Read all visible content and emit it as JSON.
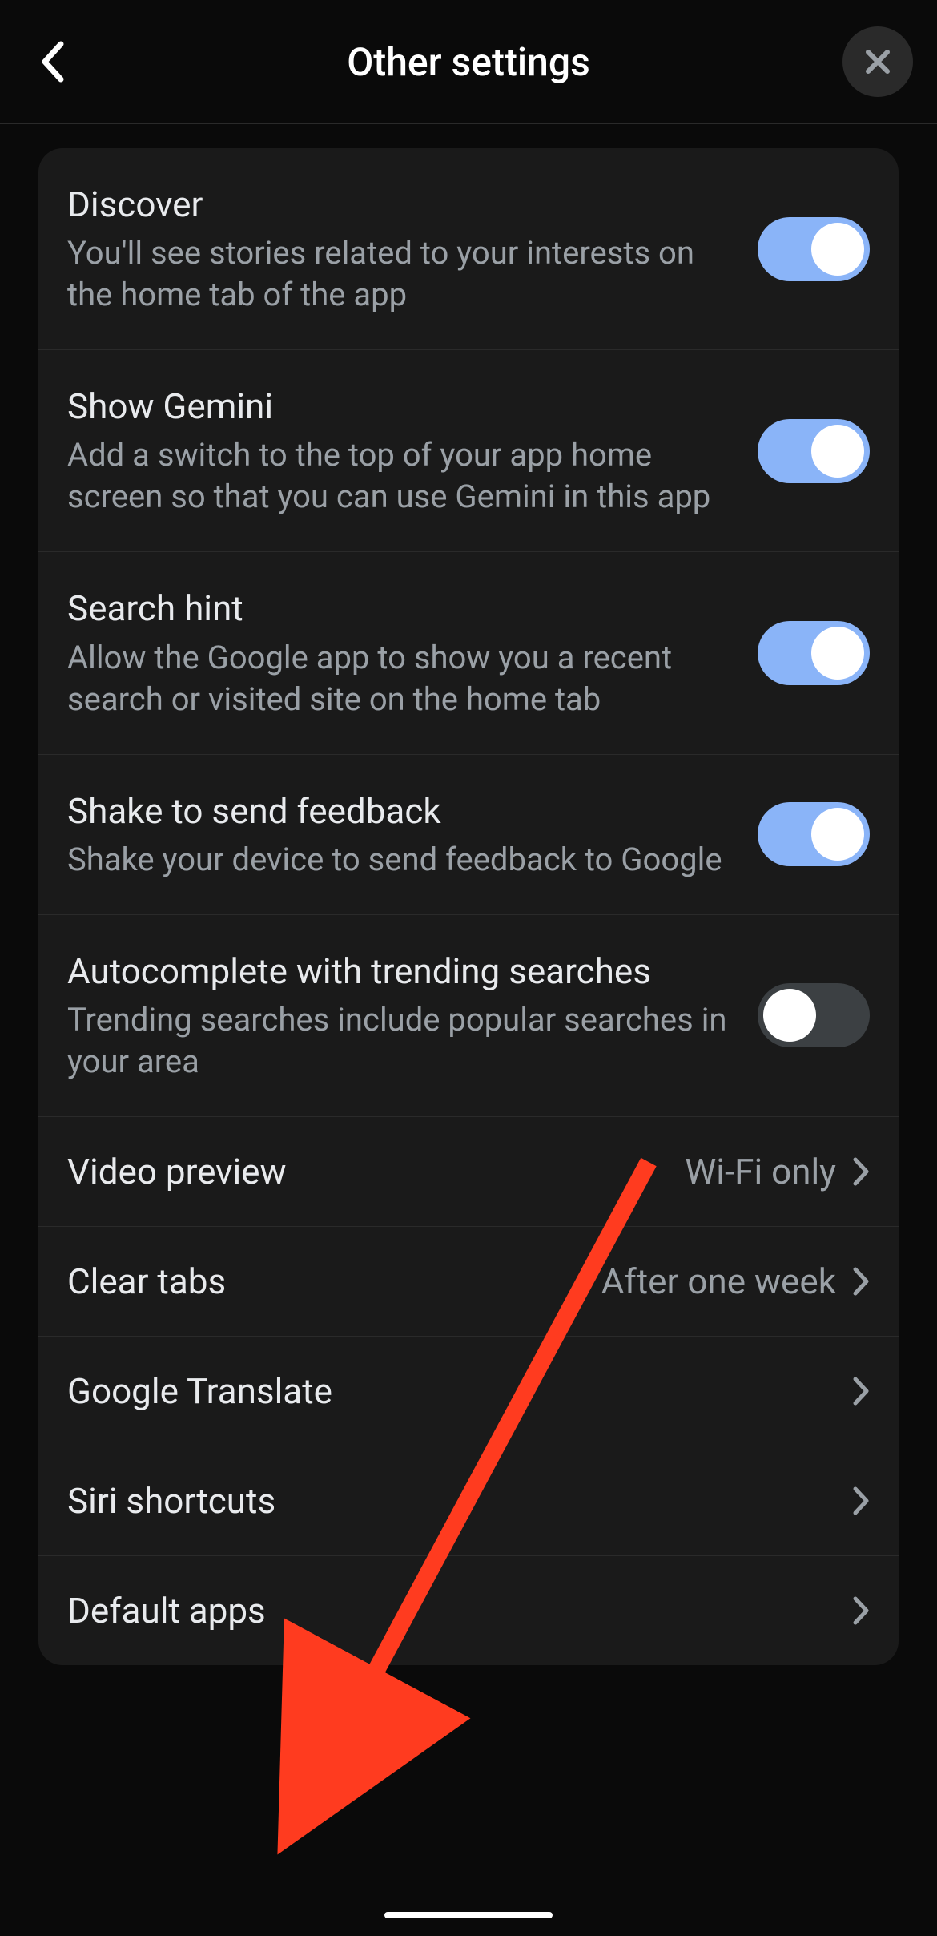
{
  "header": {
    "title": "Other settings"
  },
  "settings": {
    "toggles": [
      {
        "title": "Discover",
        "desc": "You'll see stories related to your interests on the home tab of the app",
        "on": true,
        "name": "discover"
      },
      {
        "title": "Show Gemini",
        "desc": "Add a switch to the top of your app home screen so that you can use Gemini in this app",
        "on": true,
        "name": "show-gemini"
      },
      {
        "title": "Search hint",
        "desc": "Allow the Google app to show you a recent search or visited site on the home tab",
        "on": true,
        "name": "search-hint"
      },
      {
        "title": "Shake to send feedback",
        "desc": "Shake your device to send feedback to Google",
        "on": true,
        "name": "shake-feedback"
      },
      {
        "title": "Autocomplete with trending searches",
        "desc": "Trending searches include popular searches in your area",
        "on": false,
        "name": "autocomplete-trending"
      }
    ],
    "navs": [
      {
        "title": "Video preview",
        "value": "Wi-Fi only",
        "name": "video-preview"
      },
      {
        "title": "Clear tabs",
        "value": "After one week",
        "name": "clear-tabs"
      },
      {
        "title": "Google Translate",
        "value": "",
        "name": "google-translate"
      },
      {
        "title": "Siri shortcuts",
        "value": "",
        "name": "siri-shortcuts"
      },
      {
        "title": "Default apps",
        "value": "",
        "name": "default-apps"
      }
    ]
  }
}
